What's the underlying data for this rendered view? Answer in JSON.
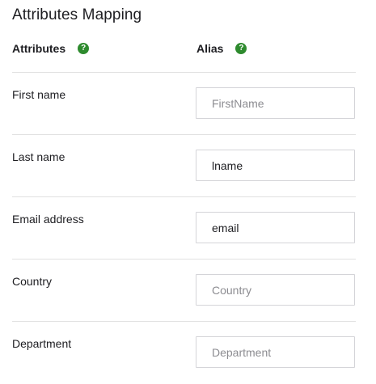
{
  "title": "Attributes Mapping",
  "headers": {
    "attributes": "Attributes",
    "alias": "Alias",
    "help_glyph": "?"
  },
  "rows": [
    {
      "label": "First name",
      "value": "",
      "placeholder": "FirstName"
    },
    {
      "label": "Last name",
      "value": "lname",
      "placeholder": ""
    },
    {
      "label": "Email address",
      "value": "email",
      "placeholder": ""
    },
    {
      "label": "Country",
      "value": "",
      "placeholder": "Country"
    },
    {
      "label": "Department",
      "value": "",
      "placeholder": "Department"
    }
  ],
  "colors": {
    "help_icon": "#2e8b2e",
    "divider": "#e1e1e1",
    "text": "#1d1d21",
    "placeholder": "#8c8c91"
  }
}
